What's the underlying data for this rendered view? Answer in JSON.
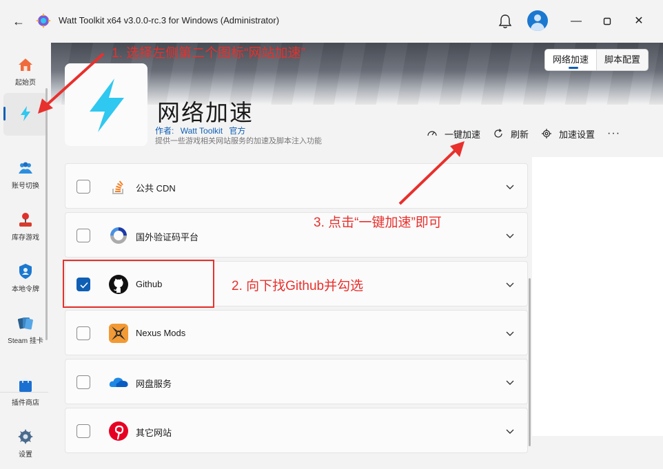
{
  "window": {
    "title": "Watt Toolkit x64 v3.0.0-rc.3 for Windows (Administrator)",
    "controls": [
      "minimize",
      "maximize",
      "close"
    ]
  },
  "sidebar": {
    "items": [
      {
        "label": "起始页",
        "icon": "home-icon",
        "active": false
      },
      {
        "label": "",
        "icon": "lightning-icon",
        "active": true
      },
      {
        "label": "账号切换",
        "icon": "users-icon",
        "active": false
      },
      {
        "label": "库存游戏",
        "icon": "joystick-icon",
        "active": false
      },
      {
        "label": "本地令牌",
        "icon": "shield-user-icon",
        "active": false
      },
      {
        "label": "Steam 挂卡",
        "icon": "cards-icon",
        "active": false
      },
      {
        "label": "插件商店",
        "icon": "shopping-bag-icon",
        "active": false
      },
      {
        "label": "设置",
        "icon": "gear-icon",
        "active": false
      }
    ]
  },
  "tabs": [
    {
      "label": "网络加速",
      "active": true
    },
    {
      "label": "脚本配置",
      "active": false
    }
  ],
  "plugin": {
    "title": "网络加速",
    "author_label": "作者:",
    "author_name": "Watt Toolkit",
    "author_badge": "官方",
    "description": "提供一些游戏相关网站服务的加速及脚本注入功能"
  },
  "actions": {
    "one_click": "一键加速",
    "refresh": "刷新",
    "settings": "加速设置",
    "more": "···"
  },
  "services": [
    {
      "name": "公共 CDN",
      "icon": "stack-overflow-icon",
      "checked": false
    },
    {
      "name": "国外验证码平台",
      "icon": "recaptcha-icon",
      "checked": false
    },
    {
      "name": "Github",
      "icon": "github-icon",
      "checked": true
    },
    {
      "name": "Nexus Mods",
      "icon": "nexus-mods-icon",
      "checked": false
    },
    {
      "name": "网盘服务",
      "icon": "onedrive-icon",
      "checked": false
    },
    {
      "name": "其它网站",
      "icon": "pinterest-icon",
      "checked": false
    }
  ],
  "annotations": {
    "step1": "1. 选择左侧第二个图标“网站加速”",
    "step2": "2. 向下找Github并勾选",
    "step3": "3. 点击“一键加速”即可"
  },
  "colors": {
    "accent": "#0f5fb5",
    "annotation_red": "#e8302c",
    "bolt": "#2ec8f0"
  }
}
